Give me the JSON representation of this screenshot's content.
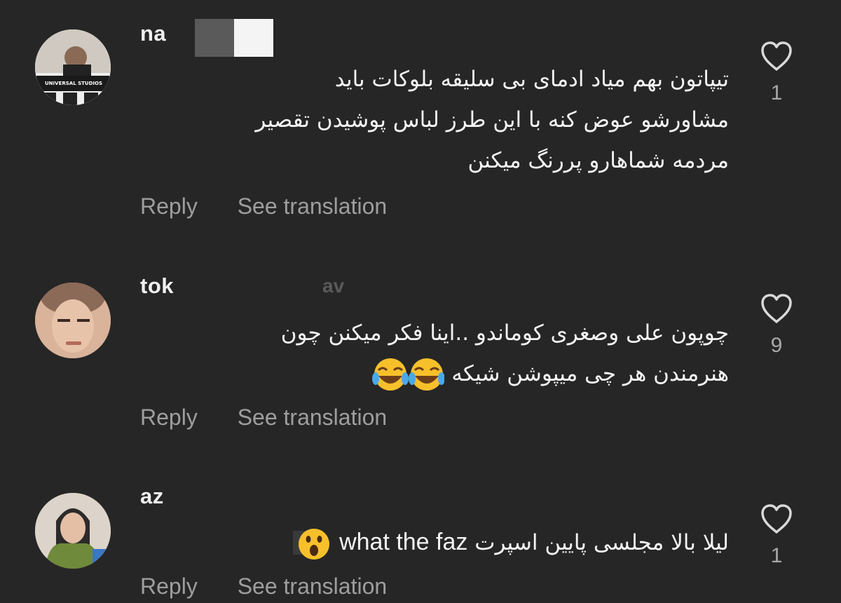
{
  "comments": [
    {
      "username": "na",
      "lines": [
        "تیپاتون بهم میاد ادمای بی سلیقه بلوکات باید",
        "مشاورشو عوض کنه با این طرز لباس پوشیدن تقصیر",
        "مردمه شماهارو پررنگ میکنن"
      ],
      "likes": "1",
      "reply_label": "Reply",
      "translate_label": "See translation",
      "avatar_text": "UNIVERSAL STUDIOS"
    },
    {
      "username": "tok",
      "username_faded": "av",
      "lines": [
        "چوپون علی وصغری کوماندو ..اینا فکر میکنن چون",
        "هنرمندن هر چی میپوشن شیکه"
      ],
      "likes": "9",
      "reply_label": "Reply",
      "translate_label": "See translation"
    },
    {
      "username": "az",
      "lines_part": "لیلا بالا مجلسی پایین اسپرت",
      "latin_part": "what the faz",
      "likes": "1",
      "reply_label": "Reply",
      "translate_label": "See translation"
    }
  ],
  "colors": {
    "background": "#262626",
    "text": "#f5f5f5",
    "muted": "#9e9e9e",
    "emoji": "#f7c02b"
  },
  "icons": [
    "heart-icon",
    "laughing-emoji",
    "surprised-emoji"
  ]
}
